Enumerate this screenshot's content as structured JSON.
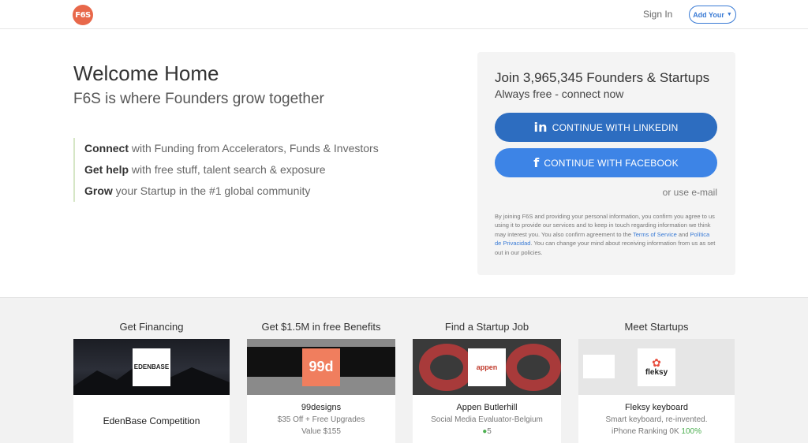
{
  "header": {
    "logo_text": "F6S",
    "signin_label": "Sign In",
    "addyour_label": "Add Your"
  },
  "hero": {
    "title": "Welcome Home",
    "tagline": "F6S is where Founders grow together",
    "features": [
      {
        "bold": "Connect",
        "rest": " with Funding from Accelerators, Funds & Investors"
      },
      {
        "bold": "Get help",
        "rest": " with free stuff, talent search & exposure"
      },
      {
        "bold": "Grow",
        "rest": " your Startup in the #1 global community"
      }
    ]
  },
  "join": {
    "title": "Join 3,965,345 Founders & Startups",
    "subtitle": "Always free - connect now",
    "linkedin_label": "CONTINUE WITH LINKEDIN",
    "facebook_label": "CONTINUE WITH FACEBOOK",
    "or_email": "or use e-mail",
    "disclaimer_1": "By joining F6S and providing your personal information, you confirm you agree to us using it to provide our services and to keep in touch regarding information we think may interest you. You also confirm agreement to the ",
    "terms_link": "Terms of Service",
    "and_text": " and ",
    "privacy_link": "Política de Privacidad",
    "disclaimer_2": ". You can change your mind about receiving information from us as set out in our policies.",
    "colors": {
      "linkedin": "#2d6dc0",
      "facebook": "#3d84e6"
    }
  },
  "bottom": {
    "columns": [
      {
        "title": "Get Financing",
        "name": "EdenBase Competition",
        "logo": "EDENBASE",
        "line1": "",
        "line2": ""
      },
      {
        "title": "Get $1.5M in free Benefits",
        "name": "99designs",
        "logo": "99d",
        "line1": "$35 Off + Free Upgrades",
        "line2": "Value $155"
      },
      {
        "title": "Find a Startup Job",
        "name": "Appen Butlerhill",
        "logo": "appen",
        "line1": "Social Media Evaluator-Belgium",
        "line2": "5"
      },
      {
        "title": "Meet Startups",
        "name": "Fleksy keyboard",
        "logo": "fleksy",
        "line1": "Smart keyboard, re-invented.",
        "line2_a": "iPhone Ranking  0K",
        "line2_b": "100%"
      }
    ]
  }
}
